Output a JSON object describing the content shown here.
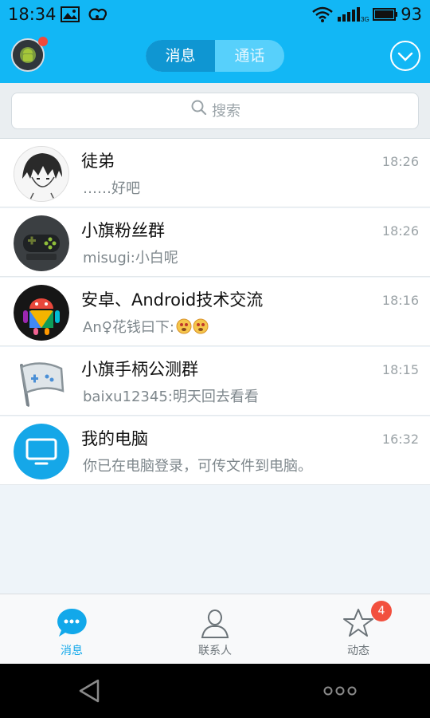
{
  "status_bar": {
    "time": "18:34",
    "battery_percent": "93",
    "network_type": "3G"
  },
  "header": {
    "tabs": [
      {
        "label": "消息",
        "active": true
      },
      {
        "label": "通话",
        "active": false
      }
    ],
    "accent_color": "#12b7f5"
  },
  "search": {
    "placeholder": "搜索"
  },
  "conversations": [
    {
      "title": "徒弟",
      "message": "……好吧",
      "time": "18:26",
      "avatar": "sketch-boy-avatar"
    },
    {
      "title": "小旗粉丝群",
      "message": "misugi:小白呢",
      "time": "18:26",
      "avatar": "gamepad-avatar"
    },
    {
      "title": "安卓、Android技术交流",
      "message": "An♀花钱曰下:",
      "time": "18:16",
      "avatar": "android-colorful-avatar"
    },
    {
      "title": "小旗手柄公测群",
      "message": "baixu12345:明天回去看看",
      "time": "18:15",
      "avatar": "flag-gamepad-avatar"
    },
    {
      "title": "我的电脑",
      "message": "你已在电脑登录，可传文件到电脑。",
      "time": "16:32",
      "avatar": "monitor-avatar"
    }
  ],
  "bottom_nav": {
    "tabs": [
      {
        "label": "消息",
        "icon": "chat-bubble-icon",
        "active": true
      },
      {
        "label": "联系人",
        "icon": "person-icon",
        "active": false
      },
      {
        "label": "动态",
        "icon": "star-icon",
        "active": false,
        "badge": "4"
      }
    ]
  }
}
